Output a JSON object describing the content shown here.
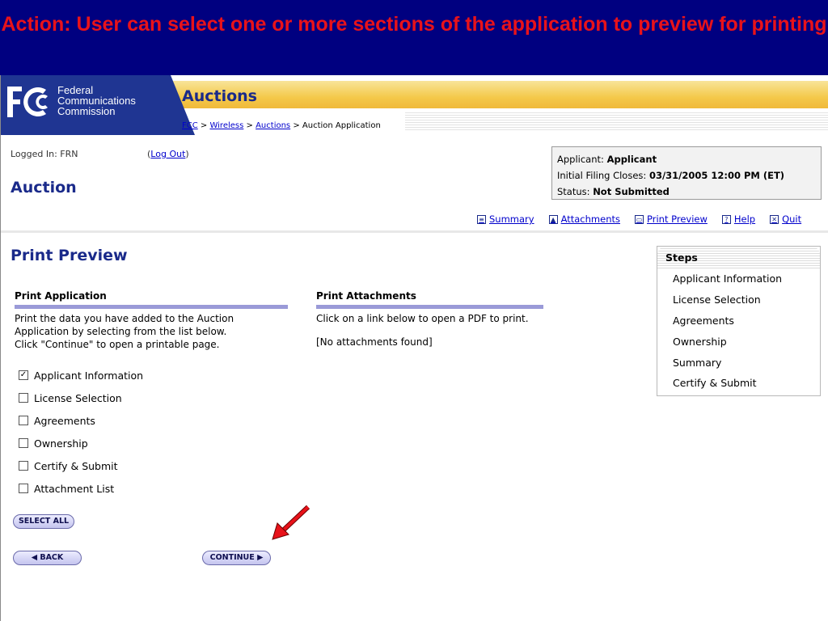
{
  "banner": {
    "text": "Action: User can select one or more sections of the application to preview for printing"
  },
  "header": {
    "org_line1": "Federal",
    "org_line2": "Communications",
    "org_line3": "Commission",
    "title": "Auctions",
    "breadcrumb": {
      "fcc": "FCC",
      "sep": ">",
      "wireless": "Wireless",
      "auctions": "Auctions",
      "current": "Auction Application"
    }
  },
  "session": {
    "logged_in": "Logged In: FRN",
    "logout_label": "Log Out"
  },
  "page_title": "Auction",
  "applicant_box": {
    "applicant_label": "Applicant:",
    "applicant_value": "Applicant",
    "closes_label": "Initial Filing Closes:",
    "closes_value": "03/31/2005 12:00 PM (ET)",
    "status_label": "Status:",
    "status_value": "Not Submitted"
  },
  "toolbar": {
    "summary": "Summary",
    "attachments": "Attachments",
    "print_preview": "Print Preview",
    "help": "Help",
    "quit": "Quit"
  },
  "section_title": "Print Preview",
  "print_application": {
    "heading": "Print Application",
    "line1": "Print the data you have added to the Auction",
    "line2": "Application by selecting from the list below.",
    "line3": "Click \"Continue\" to open a printable page.",
    "options": [
      {
        "label": "Applicant Information",
        "checked": true
      },
      {
        "label": "License Selection",
        "checked": false
      },
      {
        "label": "Agreements",
        "checked": false
      },
      {
        "label": "Ownership",
        "checked": false
      },
      {
        "label": "Certify & Submit",
        "checked": false
      },
      {
        "label": "Attachment List",
        "checked": false
      }
    ],
    "select_all": "SELECT ALL",
    "back": "BACK",
    "continue": "CONTINUE"
  },
  "print_attachments": {
    "heading": "Print Attachments",
    "instructions": "Click on a link below to open a PDF to print.",
    "empty": "[No attachments found]"
  },
  "steps": {
    "heading": "Steps",
    "items": [
      "Applicant Information",
      "License Selection",
      "Agreements",
      "Ownership",
      "Summary",
      "Certify & Submit"
    ]
  },
  "colors": {
    "banner_bg": "#000080",
    "banner_text": "#e8121a",
    "fcc_blue": "#1f3592",
    "gold": "#f4c94a",
    "link": "#0000cc",
    "arrow": "#e8121a"
  }
}
